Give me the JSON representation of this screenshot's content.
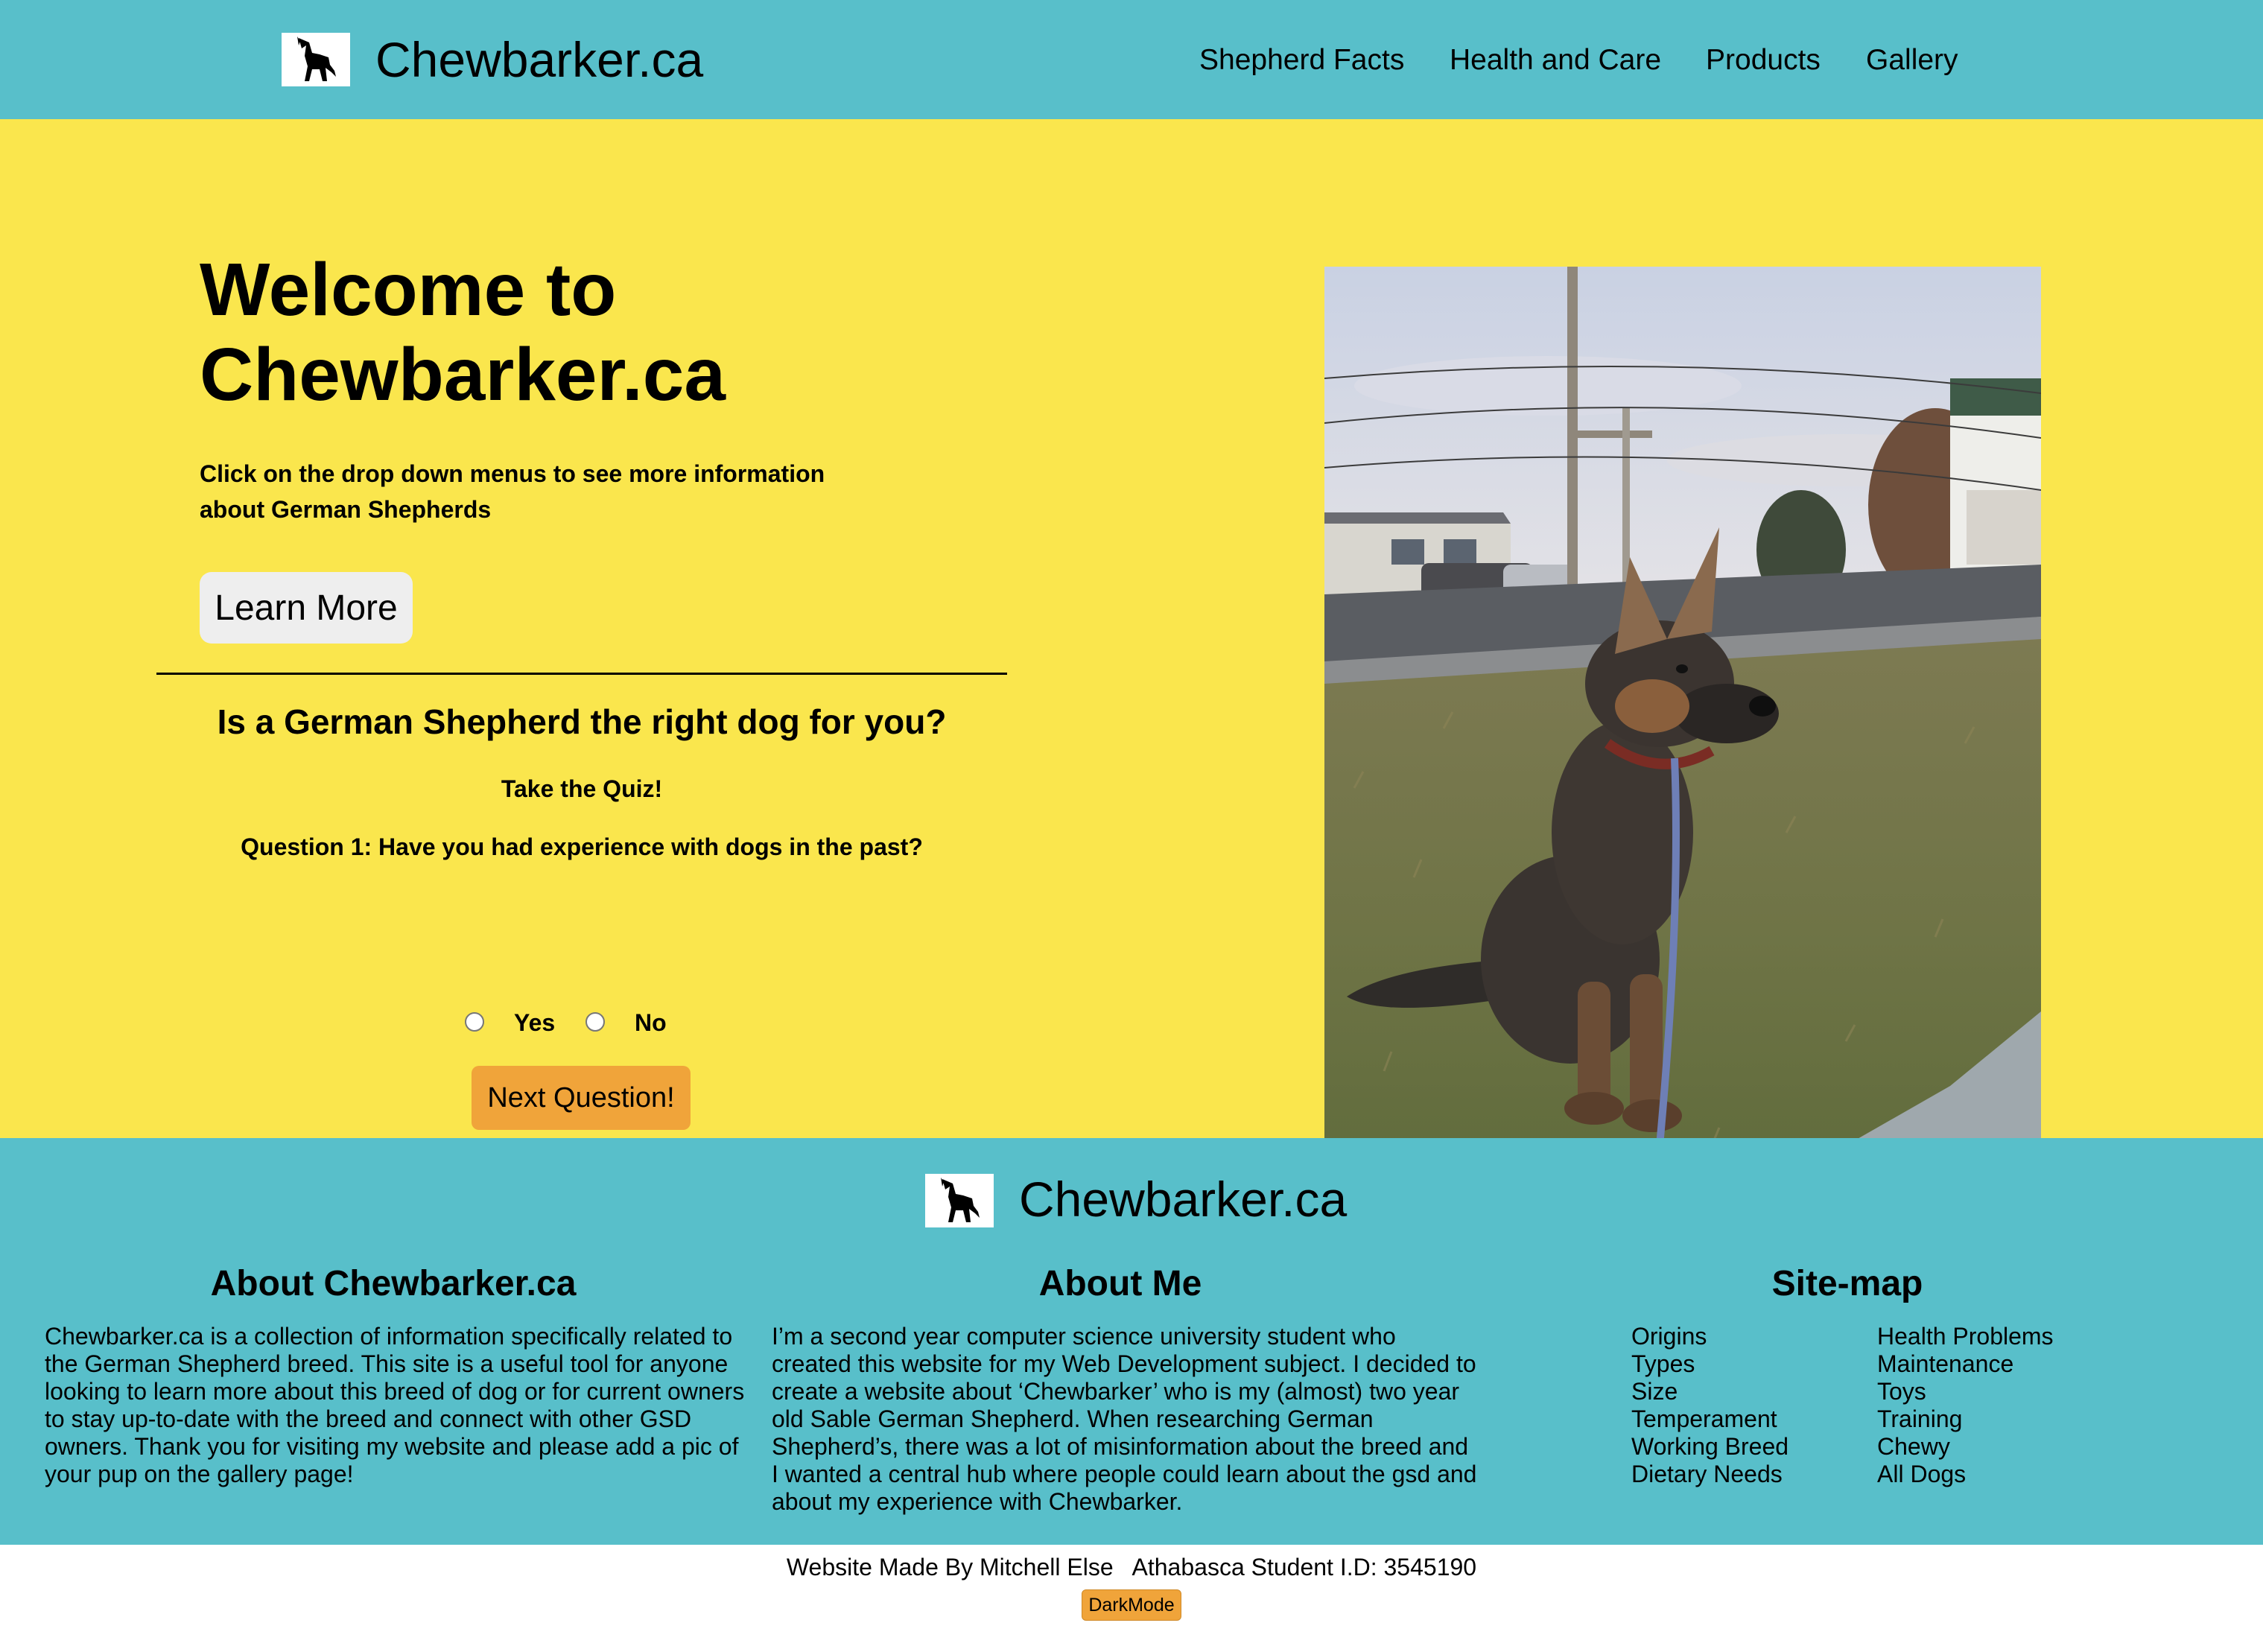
{
  "header": {
    "logo_icon": "german-shepherd-silhouette-icon",
    "brand": "Chewbarker.ca",
    "nav": [
      "Shepherd Facts",
      "Health and Care",
      "Products",
      "Gallery"
    ]
  },
  "hero": {
    "title": "Welcome to Chewbarker.ca",
    "subtitle": "Click on the drop down menus to see more information about German Shepherds",
    "learn_more": "Learn More",
    "photo_icon": "german-shepherd-puppy-photo"
  },
  "quiz": {
    "title": "Is a German Shepherd the right dog for you?",
    "take": "Take the Quiz!",
    "question": "Question 1: Have you had experience with dogs in the past?",
    "options": [
      "Yes",
      "No"
    ],
    "next": "Next Question!"
  },
  "footer": {
    "brand": "Chewbarker.ca",
    "about_site": {
      "heading": "About Chewbarker.ca",
      "text": "Chewbarker.ca is a collection of information specifically related to the German Shepherd breed. This site is a useful tool for anyone looking to learn more about this breed of dog or for current owners to stay up-to-date with the breed and connect with other GSD owners. Thank you for visiting my website and please add a pic of your pup on the gallery page!"
    },
    "about_me": {
      "heading": "About Me",
      "text": "I’m a second year computer science university student who created this website for my Web Development subject. I decided to create a website about ‘Chewbarker’ who is my (almost) two year old Sable German Shepherd. When researching German Shepherd’s, there was a lot of misinformation about the breed and I wanted a central hub where people could learn about the gsd and about my experience with Chewbarker."
    },
    "sitemap": {
      "heading": "Site-map",
      "left": [
        "Origins",
        "Types",
        "Size",
        "Temperament",
        "Working Breed",
        "Dietary Needs"
      ],
      "right": [
        "Health Problems",
        "Maintenance",
        "Toys",
        "Training",
        "Chewy",
        "All Dogs"
      ]
    }
  },
  "bottom": {
    "credit": "Website Made By Mitchell Else   Athabasca Student I.D: 3545190",
    "darkmode": "DarkMode"
  },
  "colors": {
    "header_bg": "#58bfca",
    "hero_bg": "#fae64d",
    "accent_button": "#f0a43a"
  }
}
